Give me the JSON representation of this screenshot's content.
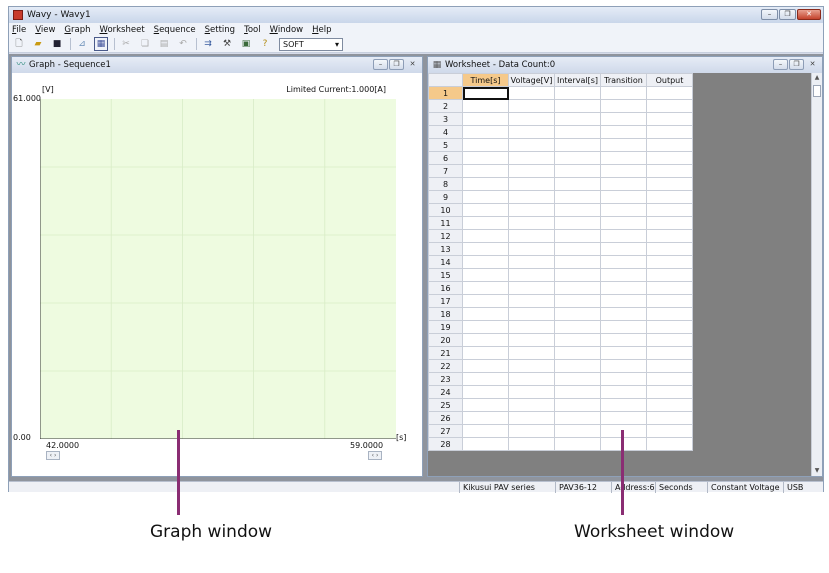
{
  "app": {
    "title": "Wavy - Wavy1",
    "window_buttons": {
      "minimize": "–",
      "restore": "❐",
      "close": "✕"
    }
  },
  "menu": [
    "File",
    "View",
    "Graph",
    "Worksheet",
    "Sequence",
    "Setting",
    "Tool",
    "Window",
    "Help"
  ],
  "toolbar": {
    "icons": [
      "new-icon",
      "open-icon",
      "save-icon",
      "graph-icon",
      "worksheet-icon",
      "cut-icon",
      "copy-icon",
      "paste-icon",
      "undo-icon",
      "transfer-icon",
      "settings-icon",
      "monitor-icon",
      "help-icon"
    ],
    "mode_value": "SOFT"
  },
  "graph_window": {
    "title": "Graph - Sequence1",
    "y_unit": "[V]",
    "y_max": "61.000",
    "y_min": "0.00",
    "limit_label": "Limited Current:1.000[A]",
    "x_min": "42.0000",
    "x_max": "59.0000",
    "x_unit": "[s]",
    "plot_bg": "#eefbe0",
    "grid_color": "#d8ecc6"
  },
  "worksheet_window": {
    "title": "Worksheet - Data Count:0",
    "columns": [
      "Time[s]",
      "Voltage[V]",
      "Interval[s]",
      "Transition",
      "Output"
    ],
    "rows": [
      "1",
      "2",
      "3",
      "4",
      "5",
      "6",
      "7",
      "8",
      "9",
      "10",
      "11",
      "12",
      "13",
      "14",
      "15",
      "16",
      "17",
      "18",
      "19",
      "20",
      "21",
      "22",
      "23",
      "24",
      "25",
      "26",
      "27",
      "28"
    ]
  },
  "statusbar": [
    "Kikusui PAV series",
    "PAV36-12",
    "Address:6",
    "Seconds",
    "Constant Voltage",
    "USB"
  ],
  "callouts": {
    "graph": "Graph window",
    "worksheet": "Worksheet window"
  },
  "colors": {
    "accent": "#8a2d73",
    "header_highlight": "#f5c98a"
  }
}
